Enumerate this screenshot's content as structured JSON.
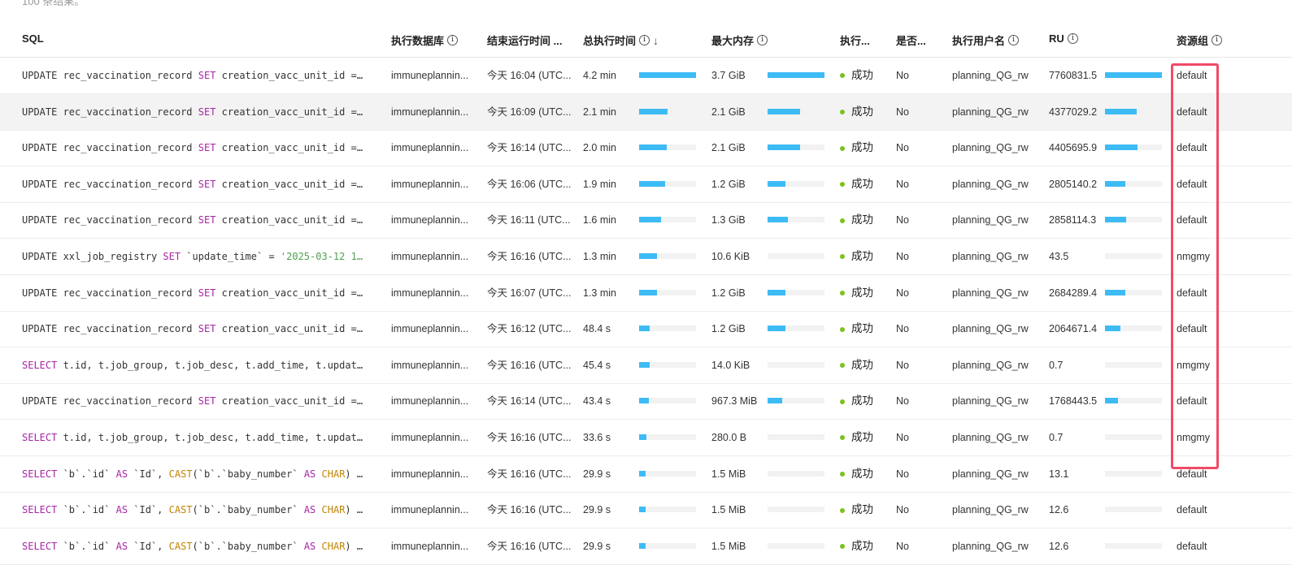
{
  "summary": "100 条结果。",
  "headers": {
    "sql": "SQL",
    "db": "执行数据库",
    "end_time": "结束运行时间 ...",
    "total_time": "总执行时间",
    "max_mem": "最大内存",
    "status": "执行...",
    "flag": "是否...",
    "user": "执行用户名",
    "ru": "RU",
    "group": "资源组"
  },
  "colors": {
    "bar": "#3dbbf5",
    "success": "#7cc11d",
    "highlight_box": "#ef4b66"
  },
  "rows": [
    {
      "sql": [
        [
          "",
          "UPDATE rec_vaccination_record "
        ],
        [
          "kw",
          "SET"
        ],
        [
          "",
          " creation_vacc_unit_id =…"
        ]
      ],
      "db": "immuneplannin...",
      "end": "今天 16:04 (UTC...",
      "time": "4.2 min",
      "time_frac": 1,
      "mem": "3.7 GiB",
      "mem_frac": 1,
      "status": "成功",
      "flag": "No",
      "user": "planning_QG_rw",
      "ru": "7760831.5",
      "ru_frac": 1,
      "group": "default"
    },
    {
      "sql": [
        [
          "",
          "UPDATE rec_vaccination_record "
        ],
        [
          "kw",
          "SET"
        ],
        [
          "",
          " creation_vacc_unit_id =…"
        ]
      ],
      "db": "immuneplannin...",
      "end": "今天 16:09 (UTC...",
      "time": "2.1 min",
      "time_frac": 0.5,
      "mem": "2.1 GiB",
      "mem_frac": 0.57,
      "status": "成功",
      "flag": "No",
      "user": "planning_QG_rw",
      "ru": "4377029.2",
      "ru_frac": 0.56,
      "group": "default",
      "hl": true
    },
    {
      "sql": [
        [
          "",
          "UPDATE rec_vaccination_record "
        ],
        [
          "kw",
          "SET"
        ],
        [
          "",
          " creation_vacc_unit_id =…"
        ]
      ],
      "db": "immuneplannin...",
      "end": "今天 16:14 (UTC...",
      "time": "2.0 min",
      "time_frac": 0.48,
      "mem": "2.1 GiB",
      "mem_frac": 0.57,
      "status": "成功",
      "flag": "No",
      "user": "planning_QG_rw",
      "ru": "4405695.9",
      "ru_frac": 0.57,
      "group": "default"
    },
    {
      "sql": [
        [
          "",
          "UPDATE rec_vaccination_record "
        ],
        [
          "kw",
          "SET"
        ],
        [
          "",
          " creation_vacc_unit_id =…"
        ]
      ],
      "db": "immuneplannin...",
      "end": "今天 16:06 (UTC...",
      "time": "1.9 min",
      "time_frac": 0.45,
      "mem": "1.2 GiB",
      "mem_frac": 0.32,
      "status": "成功",
      "flag": "No",
      "user": "planning_QG_rw",
      "ru": "2805140.2",
      "ru_frac": 0.36,
      "group": "default"
    },
    {
      "sql": [
        [
          "",
          "UPDATE rec_vaccination_record "
        ],
        [
          "kw",
          "SET"
        ],
        [
          "",
          " creation_vacc_unit_id =…"
        ]
      ],
      "db": "immuneplannin...",
      "end": "今天 16:11 (UTC...",
      "time": "1.6 min",
      "time_frac": 0.38,
      "mem": "1.3 GiB",
      "mem_frac": 0.35,
      "status": "成功",
      "flag": "No",
      "user": "planning_QG_rw",
      "ru": "2858114.3",
      "ru_frac": 0.37,
      "group": "default"
    },
    {
      "sql": [
        [
          "",
          "UPDATE xxl_job_registry "
        ],
        [
          "kw",
          "SET"
        ],
        [
          "",
          " `update_time` = "
        ],
        [
          "str",
          "'2025-03-12 1…"
        ]
      ],
      "db": "immuneplannin...",
      "end": "今天 16:16 (UTC...",
      "time": "1.3 min",
      "time_frac": 0.31,
      "mem": "10.6 KiB",
      "mem_frac": 0,
      "status": "成功",
      "flag": "No",
      "user": "planning_QG_rw",
      "ru": "43.5",
      "ru_frac": 0,
      "group": "nmgmy"
    },
    {
      "sql": [
        [
          "",
          "UPDATE rec_vaccination_record "
        ],
        [
          "kw",
          "SET"
        ],
        [
          "",
          " creation_vacc_unit_id =…"
        ]
      ],
      "db": "immuneplannin...",
      "end": "今天 16:07 (UTC...",
      "time": "1.3 min",
      "time_frac": 0.31,
      "mem": "1.2 GiB",
      "mem_frac": 0.32,
      "status": "成功",
      "flag": "No",
      "user": "planning_QG_rw",
      "ru": "2684289.4",
      "ru_frac": 0.35,
      "group": "default"
    },
    {
      "sql": [
        [
          "",
          "UPDATE rec_vaccination_record "
        ],
        [
          "kw",
          "SET"
        ],
        [
          "",
          " creation_vacc_unit_id =…"
        ]
      ],
      "db": "immuneplannin...",
      "end": "今天 16:12 (UTC...",
      "time": "48.4 s",
      "time_frac": 0.19,
      "mem": "1.2 GiB",
      "mem_frac": 0.32,
      "status": "成功",
      "flag": "No",
      "user": "planning_QG_rw",
      "ru": "2064671.4",
      "ru_frac": 0.27,
      "group": "default"
    },
    {
      "sql": [
        [
          "kw",
          "SELECT"
        ],
        [
          "",
          " t.id, t.job_group, t.job_desc, t.add_time, t.updat…"
        ]
      ],
      "db": "immuneplannin...",
      "end": "今天 16:16 (UTC...",
      "time": "45.4 s",
      "time_frac": 0.18,
      "mem": "14.0 KiB",
      "mem_frac": 0,
      "status": "成功",
      "flag": "No",
      "user": "planning_QG_rw",
      "ru": "0.7",
      "ru_frac": 0,
      "group": "nmgmy"
    },
    {
      "sql": [
        [
          "",
          "UPDATE rec_vaccination_record "
        ],
        [
          "kw",
          "SET"
        ],
        [
          "",
          " creation_vacc_unit_id =…"
        ]
      ],
      "db": "immuneplannin...",
      "end": "今天 16:14 (UTC...",
      "time": "43.4 s",
      "time_frac": 0.17,
      "mem": "967.3 MiB",
      "mem_frac": 0.26,
      "status": "成功",
      "flag": "No",
      "user": "planning_QG_rw",
      "ru": "1768443.5",
      "ru_frac": 0.23,
      "group": "default"
    },
    {
      "sql": [
        [
          "kw",
          "SELECT"
        ],
        [
          "",
          " t.id, t.job_group, t.job_desc, t.add_time, t.updat…"
        ]
      ],
      "db": "immuneplannin...",
      "end": "今天 16:16 (UTC...",
      "time": "33.6 s",
      "time_frac": 0.13,
      "mem": "280.0 B",
      "mem_frac": 0,
      "status": "成功",
      "flag": "No",
      "user": "planning_QG_rw",
      "ru": "0.7",
      "ru_frac": 0,
      "group": "nmgmy"
    },
    {
      "sql": [
        [
          "kw",
          "SELECT"
        ],
        [
          "",
          " `b`.`id` "
        ],
        [
          "kw",
          "AS"
        ],
        [
          "",
          " `Id`, "
        ],
        [
          "fn",
          "CAST"
        ],
        [
          "",
          "(`b`.`baby_number` "
        ],
        [
          "kw",
          "AS"
        ],
        [
          "",
          " "
        ],
        [
          "fn",
          "CHAR"
        ],
        [
          "",
          ") …"
        ]
      ],
      "db": "immuneplannin...",
      "end": "今天 16:16 (UTC...",
      "time": "29.9 s",
      "time_frac": 0.12,
      "mem": "1.5 MiB",
      "mem_frac": 0,
      "status": "成功",
      "flag": "No",
      "user": "planning_QG_rw",
      "ru": "13.1",
      "ru_frac": 0,
      "group": "default"
    },
    {
      "sql": [
        [
          "kw",
          "SELECT"
        ],
        [
          "",
          " `b`.`id` "
        ],
        [
          "kw",
          "AS"
        ],
        [
          "",
          " `Id`, "
        ],
        [
          "fn",
          "CAST"
        ],
        [
          "",
          "(`b`.`baby_number` "
        ],
        [
          "kw",
          "AS"
        ],
        [
          "",
          " "
        ],
        [
          "fn",
          "CHAR"
        ],
        [
          "",
          ") …"
        ]
      ],
      "db": "immuneplannin...",
      "end": "今天 16:16 (UTC...",
      "time": "29.9 s",
      "time_frac": 0.12,
      "mem": "1.5 MiB",
      "mem_frac": 0,
      "status": "成功",
      "flag": "No",
      "user": "planning_QG_rw",
      "ru": "12.6",
      "ru_frac": 0,
      "group": "default"
    },
    {
      "sql": [
        [
          "kw",
          "SELECT"
        ],
        [
          "",
          " `b`.`id` "
        ],
        [
          "kw",
          "AS"
        ],
        [
          "",
          " `Id`, "
        ],
        [
          "fn",
          "CAST"
        ],
        [
          "",
          "(`b`.`baby_number` "
        ],
        [
          "kw",
          "AS"
        ],
        [
          "",
          " "
        ],
        [
          "fn",
          "CHAR"
        ],
        [
          "",
          ") …"
        ]
      ],
      "db": "immuneplannin...",
      "end": "今天 16:16 (UTC...",
      "time": "29.9 s",
      "time_frac": 0.12,
      "mem": "1.5 MiB",
      "mem_frac": 0,
      "status": "成功",
      "flag": "No",
      "user": "planning_QG_rw",
      "ru": "12.6",
      "ru_frac": 0,
      "group": "default"
    }
  ]
}
